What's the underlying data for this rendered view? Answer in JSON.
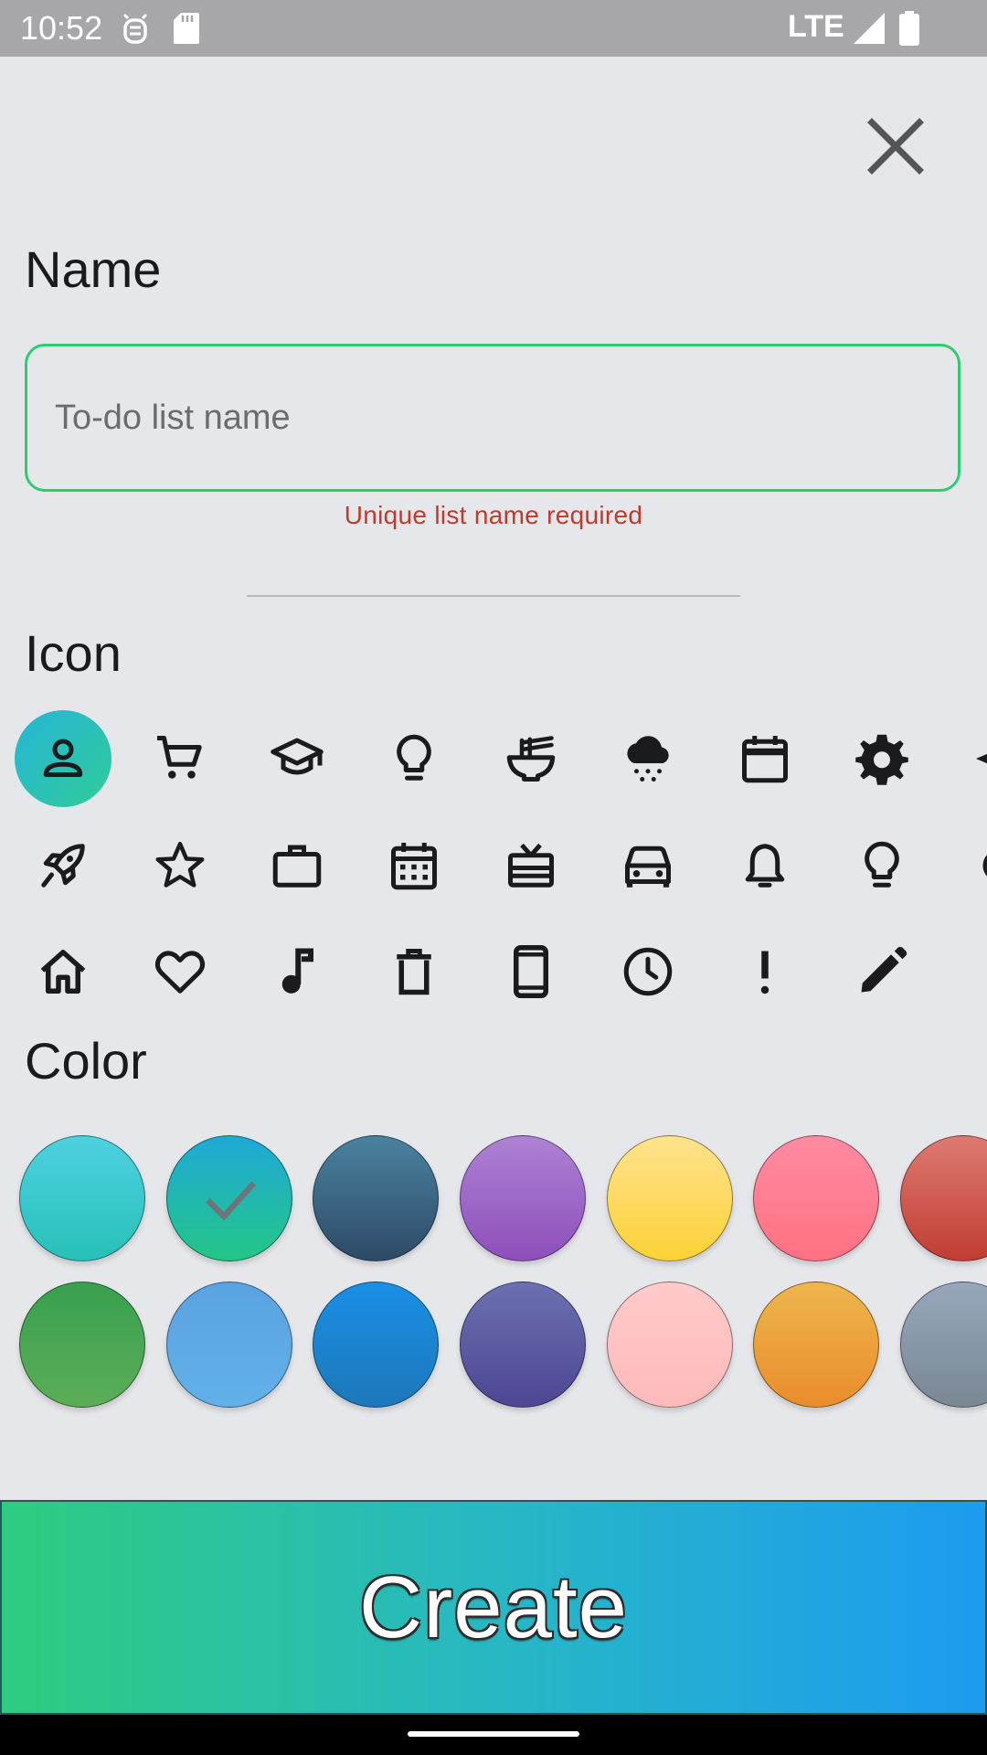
{
  "status_bar": {
    "time": "10:52",
    "network": "LTE"
  },
  "form": {
    "name_title": "Name",
    "name_placeholder": "To-do list name",
    "name_value": "",
    "error": "Unique list name required",
    "icon_title": "Icon",
    "color_title": "Color",
    "create_label": "Create"
  },
  "icons": [
    [
      "person-icon",
      "shopping-cart-icon",
      "graduation-cap-icon",
      "lightbulb-icon",
      "ramen-bowl-icon",
      "cloud-snow-icon",
      "calendar-icon",
      "gear-icon",
      "plane-icon"
    ],
    [
      "rocket-icon",
      "star-icon",
      "briefcase-icon",
      "calendar-grid-icon",
      "gift-icon",
      "car-icon",
      "bell-icon",
      "lightbulb-icon",
      "paw-icon"
    ],
    [
      "home-icon",
      "heart-icon",
      "music-note-icon",
      "trash-icon",
      "phone-icon",
      "clock-icon",
      "exclamation-icon",
      "pencil-icon"
    ]
  ],
  "selected_icon": "person-icon",
  "colors": [
    [
      "#3fcbd9",
      "#22bf92",
      "#3b6480",
      "#9b62c2",
      "#fdd452",
      "#ff7c8f",
      "#cf5248"
    ],
    [
      "#4aa653",
      "#5aa7e4",
      "#1c86d5",
      "#5b5ba2",
      "#ffc1c1",
      "#ec9b35",
      "#8593a8"
    ]
  ],
  "selected_color": "#22bf92"
}
